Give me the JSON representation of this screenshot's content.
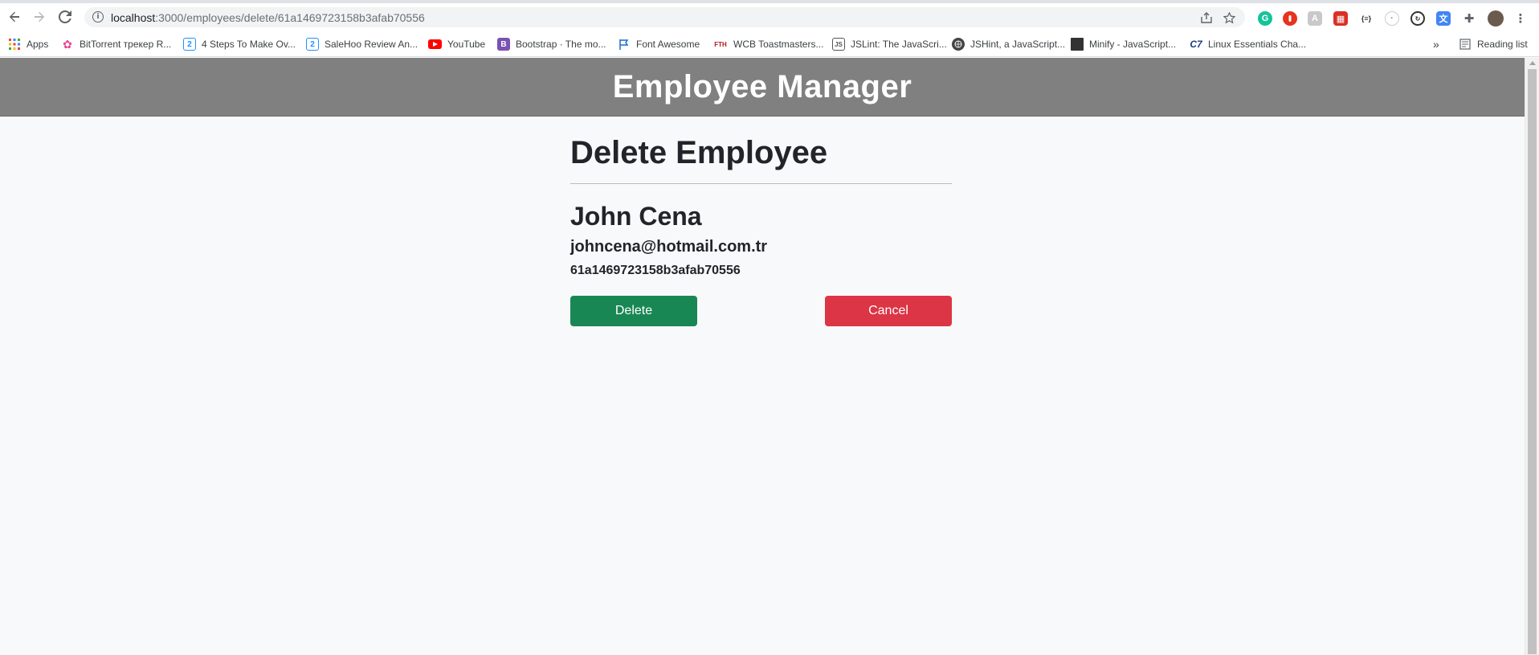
{
  "browser": {
    "url_host": "localhost",
    "url_path": ":3000/employees/delete/61a1469723158b3afab70556",
    "bookmarks": [
      {
        "label": "Apps",
        "color": "#4285f4"
      },
      {
        "label": "BitTorrent трекер R...",
        "color": "#e84393"
      },
      {
        "label": "4 Steps To Make Ov...",
        "color": "#1e90ff"
      },
      {
        "label": "SaleHoo Review An...",
        "color": "#1e90ff"
      },
      {
        "label": "YouTube",
        "color": "#ff0000"
      },
      {
        "label": "Bootstrap · The mo...",
        "color": "#7952b3"
      },
      {
        "label": "Font Awesome",
        "color": "#1c6bd1"
      },
      {
        "label": "WCB Toastmasters...",
        "color": "#b31b1b"
      },
      {
        "label": "JSLint: The JavaScri...",
        "color": "#555555"
      },
      {
        "label": "JSHint, a JavaScript...",
        "color": "#444444"
      },
      {
        "label": "Minify - JavaScript...",
        "color": "#333333"
      },
      {
        "label": "Linux Essentials Cha...",
        "color": "#1a3b8c"
      }
    ],
    "reading_list": "Reading list",
    "more_bookmarks": "»"
  },
  "header": {
    "title": "Employee Manager"
  },
  "page": {
    "heading": "Delete Employee",
    "employee": {
      "name": "John Cena",
      "email": "johncena@hotmail.com.tr",
      "id": "61a1469723158b3afab70556"
    },
    "delete_label": "Delete",
    "cancel_label": "Cancel"
  },
  "colors": {
    "header_bg": "#808080",
    "delete_btn": "#198754",
    "cancel_btn": "#dc3545"
  }
}
